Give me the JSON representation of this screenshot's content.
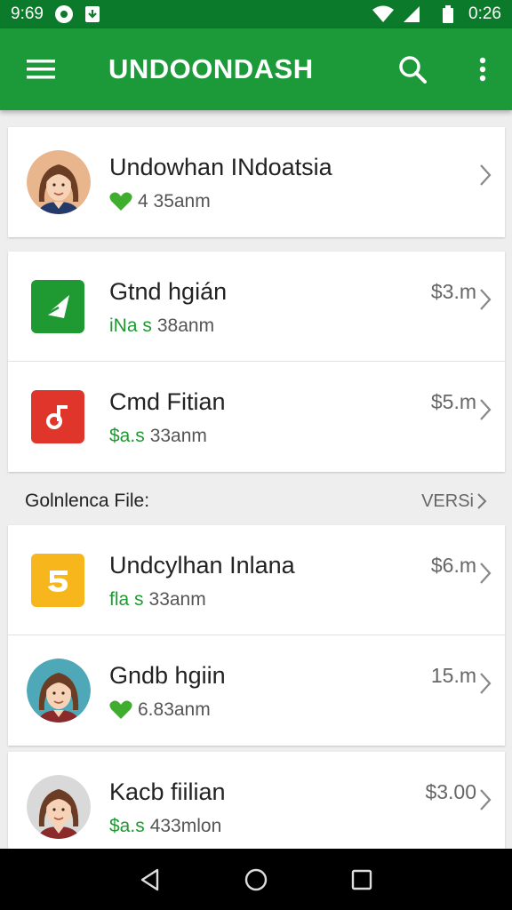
{
  "status_bar": {
    "time_left": "9:69",
    "time_right": "0:26"
  },
  "app_bar": {
    "title": "UNDOONDASH"
  },
  "colors": {
    "primary": "#1c9a3a",
    "status": "#0b7a2a",
    "accent_green": "#1f9a32"
  },
  "card1": {
    "rows": [
      {
        "title": "Undowhan INdoatsia",
        "sub_prefix": "",
        "sub": "4 35anm",
        "amount": "",
        "icon": "avatar-woman",
        "badge": "heart-icon"
      }
    ]
  },
  "card2": {
    "rows": [
      {
        "title": "Gtnd hgián",
        "sub_prefix": "iNa s",
        "sub": "38anm",
        "amount": "$3.m",
        "icon": "green-app-icon"
      },
      {
        "title": "Cmd Fitian",
        "sub_prefix": "$a.s",
        "sub": "33anm",
        "amount": "$5.m",
        "icon": "red-app-icon"
      }
    ]
  },
  "section": {
    "label": "Golnlenca File:",
    "more": "VERSi"
  },
  "card3": {
    "rows": [
      {
        "title": "Undcylhan  Inlana",
        "sub_prefix": "fla s",
        "sub": "33anm",
        "amount": "$6.m",
        "icon": "yellow-app-icon"
      },
      {
        "title": "Gndb hgiin",
        "sub_prefix": "",
        "sub": "6.83anm",
        "amount": "15.m",
        "icon": "avatar-woman",
        "badge": "heart-icon"
      }
    ]
  },
  "card4": {
    "rows": [
      {
        "title": "Kacb fiilian",
        "sub_prefix": "$a.s",
        "sub": "433mlon",
        "amount": "$3.00",
        "icon": "avatar-woman"
      }
    ]
  }
}
